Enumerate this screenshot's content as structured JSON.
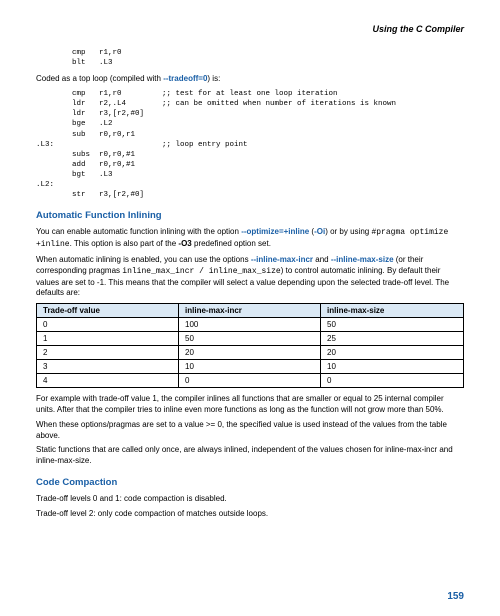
{
  "running_head": "Using the C Compiler",
  "code_block_1": "        cmp   r1,r0\n        blt   .L3",
  "para_coded_as_top": {
    "pre": "Coded as a top loop (compiled with ",
    "opt": "--tradeoff=0",
    "post": ") is:"
  },
  "code_block_2": "        cmp   r1,r0         ;; test for at least one loop iteration\n        ldr   r2,.L4        ;; can be omitted when number of iterations is known\n        ldr   r3,[r2,#0]\n        bge   .L2\n        sub   r0,r0,r1\n.L3:                        ;; loop entry point\n        subs  r0,r0,#1\n        add   r0,r0,#1\n        bgt   .L3\n.L2:\n        str   r3,[r2,#0]",
  "heading_afi": "Automatic Function Inlining",
  "para_afi_1": {
    "pre": "You can enable automatic function inlining with the option ",
    "opt1": "--optimize=+inline",
    "mid1": " (",
    "opt2": "-Oi",
    "mid2": ") or by using ",
    "pragma": "#pragma optimize +inline",
    "mid3": ". This option is also part of the ",
    "opt3": "-O3",
    "post": " predefined option set."
  },
  "para_afi_2": {
    "pre": "When automatic inlining is enabled, you can use the options ",
    "opt1": "--inline-max-incr",
    "mid1": " and ",
    "opt2": "--inline-max-size",
    "mid2": " (or their corresponding pragmas ",
    "pragmas": "inline_max_incr / inline_max_size",
    "post": ") to control automatic inlining. By default their values are set to -1. This means that the compiler will select a value depending upon the selected trade-off level. The defaults are:"
  },
  "table_headers": [
    "Trade-off value",
    "inline-max-incr",
    "inline-max-size"
  ],
  "chart_data": {
    "type": "table",
    "title": "Automatic inlining defaults by trade-off level",
    "columns": [
      "Trade-off value",
      "inline-max-incr",
      "inline-max-size"
    ],
    "rows": [
      [
        0,
        100,
        50
      ],
      [
        1,
        50,
        25
      ],
      [
        2,
        20,
        20
      ],
      [
        3,
        10,
        10
      ],
      [
        4,
        0,
        0
      ]
    ]
  },
  "para_afi_3": "For example with trade-off value 1, the compiler inlines all functions that are smaller or equal to 25 internal compiler units. After that the compiler tries to inline even more functions as long as the function will not grow more than 50%.",
  "para_afi_4": "When these options/pragmas are set to a value >= 0, the specified value is used instead of the values from the table above.",
  "para_afi_5": "Static functions that are called only once, are always inlined, independent of the values chosen for inline-max-incr and inline-max-size.",
  "heading_cc": "Code Compaction",
  "para_cc_1": "Trade-off levels 0 and 1: code compaction is disabled.",
  "para_cc_2": "Trade-off level 2: only code compaction of matches outside loops.",
  "page_number": "159"
}
